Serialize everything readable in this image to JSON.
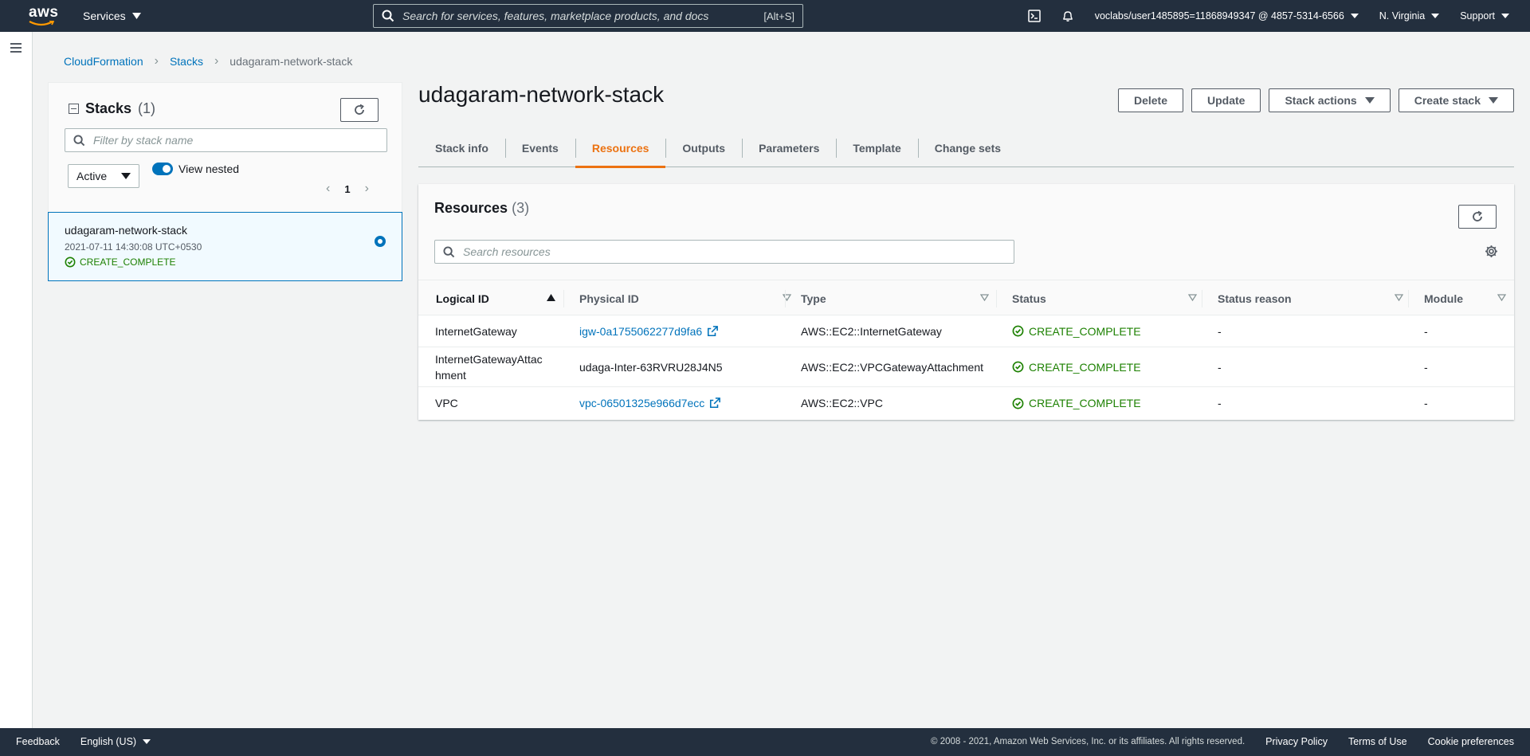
{
  "topnav": {
    "logo": "aws",
    "services_label": "Services",
    "search_placeholder": "Search for services, features, marketplace products, and docs",
    "search_shortcut": "[Alt+S]",
    "account": "voclabs/user1485895=11868949347 @ 4857-5314-6566",
    "region": "N. Virginia",
    "support": "Support"
  },
  "breadcrumb": [
    "CloudFormation",
    "Stacks",
    "udagaram-network-stack"
  ],
  "stacks_panel": {
    "title": "Stacks",
    "count": "(1)",
    "filter_placeholder": "Filter by stack name",
    "status_filter": "Active",
    "view_nested_label": "View nested",
    "page": "1",
    "items": [
      {
        "name": "udagaram-network-stack",
        "date": "2021-07-11 14:30:08 UTC+0530",
        "status": "CREATE_COMPLETE"
      }
    ]
  },
  "page_title": "udagaram-network-stack",
  "actions": {
    "delete": "Delete",
    "update": "Update",
    "stack_actions": "Stack actions",
    "create_stack": "Create stack"
  },
  "tabs": [
    "Stack info",
    "Events",
    "Resources",
    "Outputs",
    "Parameters",
    "Template",
    "Change sets"
  ],
  "active_tab": "Resources",
  "resources": {
    "title": "Resources",
    "count": "(3)",
    "search_placeholder": "Search resources",
    "columns": [
      "Logical ID",
      "Physical ID",
      "Type",
      "Status",
      "Status reason",
      "Module"
    ],
    "rows": [
      {
        "logical_id": "InternetGateway",
        "physical_id": "igw-0a1755062277d9fa6",
        "physical_link": true,
        "type": "AWS::EC2::InternetGateway",
        "status": "CREATE_COMPLETE",
        "reason": "-",
        "module": "-"
      },
      {
        "logical_id_1": "InternetGatewayAttac",
        "logical_id_2": "hment",
        "physical_id": "udaga-Inter-63RVRU28J4N5",
        "physical_link": false,
        "type": "AWS::EC2::VPCGatewayAttachment",
        "status": "CREATE_COMPLETE",
        "reason": "-",
        "module": "-"
      },
      {
        "logical_id": "VPC",
        "physical_id": "vpc-06501325e966d7ecc",
        "physical_link": true,
        "type": "AWS::EC2::VPC",
        "status": "CREATE_COMPLETE",
        "reason": "-",
        "module": "-"
      }
    ]
  },
  "footer": {
    "feedback": "Feedback",
    "language": "English (US)",
    "copyright": "© 2008 - 2021, Amazon Web Services, Inc. or its affiliates. All rights reserved.",
    "privacy": "Privacy Policy",
    "terms": "Terms of Use",
    "cookies": "Cookie preferences"
  },
  "colors": {
    "nav_bg": "#232f3e",
    "link": "#0073bb",
    "accent_tab": "#ec7211",
    "success": "#1d8102"
  }
}
